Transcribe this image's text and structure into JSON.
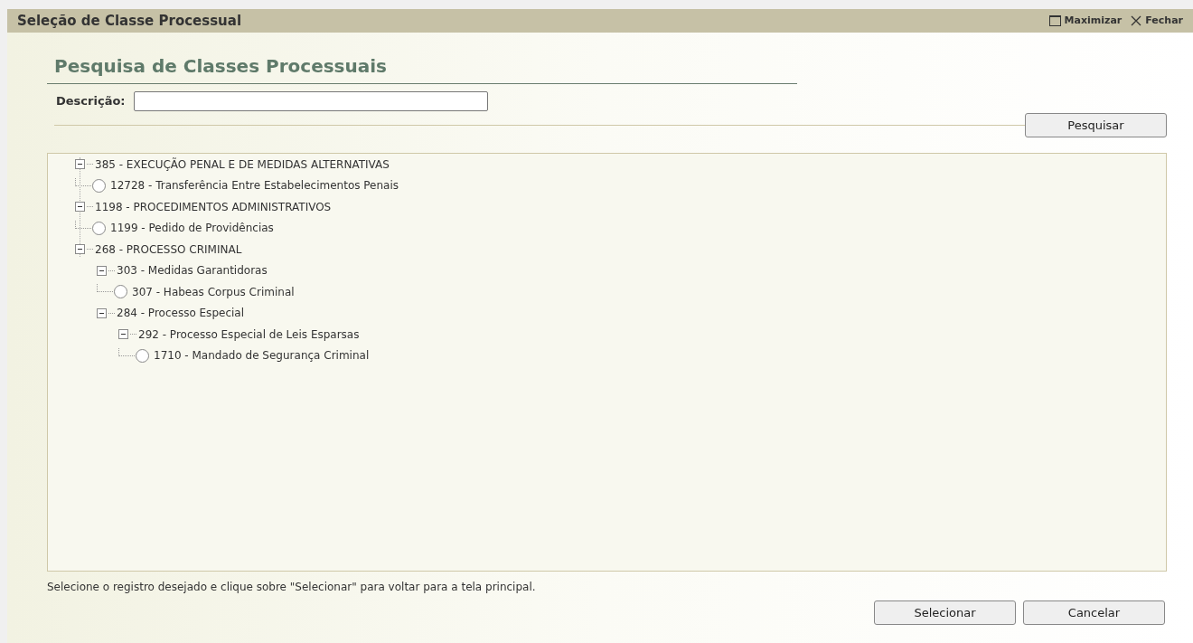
{
  "window": {
    "title": "Seleção de Classe Processual",
    "actions": [
      {
        "kind": "maximize",
        "label": "Maximizar"
      },
      {
        "kind": "close",
        "label": "Fechar"
      }
    ]
  },
  "heading": "Pesquisa de Classes Processuais",
  "search": {
    "label": "Descrição:",
    "button": "Pesquisar"
  },
  "tree": [
    {
      "kind": "group",
      "label": "385 - EXECUÇÃO PENAL E DE MEDIDAS ALTERNATIVAS",
      "expanded": true,
      "children": [
        {
          "kind": "leaf",
          "label": "12728 - Transferência Entre Estabelecimentos Penais",
          "selected": false
        }
      ]
    },
    {
      "kind": "group",
      "label": "1198 - PROCEDIMENTOS ADMINISTRATIVOS",
      "expanded": true,
      "children": [
        {
          "kind": "leaf",
          "label": "1199 - Pedido de Providências",
          "selected": false
        }
      ]
    },
    {
      "kind": "group",
      "label": "268 - PROCESSO CRIMINAL",
      "expanded": true,
      "children": [
        {
          "kind": "group",
          "label": "303 - Medidas Garantidoras",
          "expanded": true,
          "children": [
            {
              "kind": "leaf",
              "label": "307 - Habeas Corpus Criminal",
              "selected": false
            }
          ]
        },
        {
          "kind": "group",
          "label": "284 - Processo Especial",
          "expanded": true,
          "children": [
            {
              "kind": "group",
              "label": "292 - Processo Especial de Leis Esparsas",
              "expanded": true,
              "children": [
                {
                  "kind": "leaf",
                  "label": "1710 - Mandado de Segurança Criminal",
                  "selected": false
                }
              ]
            }
          ]
        }
      ]
    }
  ],
  "hint": "Selecione o registro desejado e clique sobre \"Selecionar\" para voltar para a tela principal.",
  "buttons": [
    "Selecionar",
    "Cancelar"
  ]
}
